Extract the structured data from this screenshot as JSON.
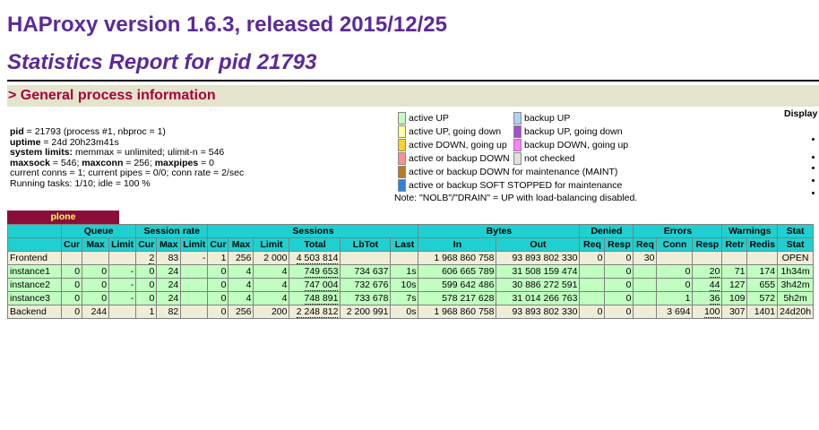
{
  "header": {
    "title": "HAProxy version 1.6.3, released 2015/12/25",
    "subtitle": "Statistics Report for pid 21793"
  },
  "section": {
    "title": "> General process information"
  },
  "process_info": {
    "pid_label": "pid",
    "pid_value": " = 21793 (process #1, nbproc = 1)",
    "uptime_label": "uptime",
    "uptime_value": " = 24d 20h23m41s",
    "limits_label": "system limits:",
    "limits_value": " memmax = unlimited; ulimit-n = 546",
    "maxsock_label": "maxsock",
    "maxsock_value": " = 546; ",
    "maxconn_label": "maxconn",
    "maxconn_value": " = 256; ",
    "maxpipes_label": "maxpipes",
    "maxpipes_value": " = 0",
    "current": "current conns = 1; current pipes = 0/0; conn rate = 2/sec",
    "tasks": "Running tasks: 1/10; idle = 100 %"
  },
  "legend": {
    "items": [
      {
        "label": "active UP",
        "color": "#c0ffc0"
      },
      {
        "label": "active UP, going down",
        "color": "#ffffa0"
      },
      {
        "label": "active DOWN, going up",
        "color": "#ffd020"
      },
      {
        "label": "active or backup DOWN",
        "color": "#ff9090"
      },
      {
        "label": "active or backup DOWN for maintenance (MAINT)",
        "color": "#c07820"
      },
      {
        "label": "active or backup SOFT STOPPED for maintenance",
        "color": "#3080e0"
      },
      {
        "label": "backup UP",
        "color": "#b0d0ff"
      },
      {
        "label": "backup UP, going down",
        "color": "#a050d0"
      },
      {
        "label": "backup DOWN, going up",
        "color": "#ff80ff"
      },
      {
        "label": "not checked",
        "color": "#e0e0e0"
      }
    ],
    "note": "Note: \"NOLB\"/\"DRAIN\" = UP with load-balancing disabled."
  },
  "display_label": "Display",
  "proxy": {
    "name": "plone",
    "groups": [
      "Queue",
      "Session rate",
      "Sessions",
      "Bytes",
      "Denied",
      "Errors",
      "Warnings",
      "Stat"
    ],
    "subheaders": [
      "Cur",
      "Max",
      "Limit",
      "Cur",
      "Max",
      "Limit",
      "Cur",
      "Max",
      "Limit",
      "Total",
      "LbTot",
      "Last",
      "In",
      "Out",
      "Req",
      "Resp",
      "Req",
      "Conn",
      "Resp",
      "Retr",
      "Redis",
      "Stat"
    ],
    "rows": [
      {
        "name": "Frontend",
        "cells": [
          "",
          "",
          "",
          "2",
          "83",
          "-",
          "1",
          "256",
          "2 000",
          "4 503 814",
          "",
          "",
          "1 968 860 758",
          "93 893 802 330",
          "0",
          "0",
          "30",
          "",
          "",
          "",
          "",
          "OPEN"
        ]
      },
      {
        "name": "instance1",
        "cells": [
          "0",
          "0",
          "-",
          "0",
          "24",
          "",
          "0",
          "4",
          "4",
          "749 653",
          "734 637",
          "1s",
          "606 665 789",
          "31 508 159 474",
          "",
          "0",
          "",
          "0",
          "20",
          "71",
          "174",
          "1h34m"
        ]
      },
      {
        "name": "instance2",
        "cells": [
          "0",
          "0",
          "-",
          "0",
          "24",
          "",
          "0",
          "4",
          "4",
          "747 004",
          "732 676",
          "10s",
          "599 642 486",
          "30 886 272 591",
          "",
          "0",
          "",
          "0",
          "44",
          "127",
          "655",
          "3h42m"
        ]
      },
      {
        "name": "instance3",
        "cells": [
          "0",
          "0",
          "-",
          "0",
          "24",
          "",
          "0",
          "4",
          "4",
          "748 891",
          "733 678",
          "7s",
          "578 217 628",
          "31 014 266 763",
          "",
          "0",
          "",
          "1",
          "36",
          "109",
          "572",
          "5h2m"
        ]
      },
      {
        "name": "Backend",
        "cells": [
          "0",
          "244",
          "",
          "1",
          "82",
          "",
          "0",
          "256",
          "200",
          "2 248 812",
          "2 200 991",
          "0s",
          "1 968 860 758",
          "93 893 802 330",
          "0",
          "0",
          "",
          "3 694",
          "100",
          "307",
          "1401",
          "24d20h"
        ]
      }
    ]
  }
}
